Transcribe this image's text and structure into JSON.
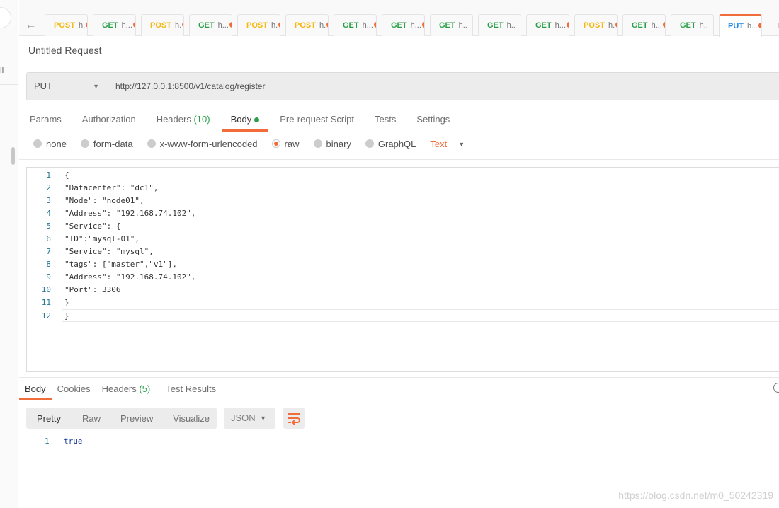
{
  "tabs": [
    {
      "method": "POST",
      "name": "h.",
      "unsaved": true
    },
    {
      "method": "GET",
      "name": "h...",
      "unsaved": true
    },
    {
      "method": "POST",
      "name": "h.",
      "unsaved": true
    },
    {
      "method": "GET",
      "name": "h...",
      "unsaved": true
    },
    {
      "method": "POST",
      "name": "h.",
      "unsaved": true
    },
    {
      "method": "POST",
      "name": "h.",
      "unsaved": true
    },
    {
      "method": "GET",
      "name": "h...",
      "unsaved": true
    },
    {
      "method": "GET",
      "name": "h...",
      "unsaved": true
    },
    {
      "method": "GET",
      "name": "h..",
      "unsaved": false
    },
    {
      "method": "GET",
      "name": "h..",
      "unsaved": false
    },
    {
      "method": "GET",
      "name": "h...",
      "unsaved": true
    },
    {
      "method": "POST",
      "name": "h.",
      "unsaved": true
    },
    {
      "method": "GET",
      "name": "h...",
      "unsaved": true
    },
    {
      "method": "GET",
      "name": "h..",
      "unsaved": false
    },
    {
      "method": "PUT",
      "name": "h...",
      "unsaved": true,
      "active": true
    }
  ],
  "colors": {
    "GET": "#27a047",
    "POST": "#f5b70c",
    "PUT": "#1e88e5",
    "accent": "#f26b3a"
  },
  "sidebar": {
    "text": "ll"
  },
  "request": {
    "title": "Untitled Request",
    "method": "PUT",
    "url": "http://127.0.0.1:8500/v1/catalog/register"
  },
  "request_tabs": {
    "params": "Params",
    "authorization": "Authorization",
    "headers": "Headers",
    "headers_count": "(10)",
    "body": "Body",
    "prerequest": "Pre-request Script",
    "tests": "Tests",
    "settings": "Settings"
  },
  "body_types": {
    "none": "none",
    "form_data": "form-data",
    "urlencoded": "x-www-form-urlencoded",
    "raw": "raw",
    "binary": "binary",
    "graphql": "GraphQL",
    "selected": "raw",
    "text_type": "Text"
  },
  "editor_lines": [
    "{",
    "\"Datacenter\": \"dc1\",",
    "\"Node\": \"node01\",",
    "\"Address\": \"192.168.74.102\",",
    "\"Service\": {",
    "\"ID\":\"mysql-01\",",
    "\"Service\": \"mysql\",",
    "\"tags\": [\"master\",\"v1\"],",
    "\"Address\": \"192.168.74.102\",",
    "\"Port\": 3306",
    "}",
    "}"
  ],
  "response_tabs": {
    "body": "Body",
    "cookies": "Cookies",
    "headers": "Headers",
    "headers_count": "(5)",
    "test_results": "Test Results"
  },
  "response_view": {
    "pretty": "Pretty",
    "raw": "Raw",
    "preview": "Preview",
    "visualize": "Visualize",
    "format": "JSON"
  },
  "response_lines": [
    "true"
  ],
  "watermark": "https://blog.csdn.net/m0_50242319"
}
